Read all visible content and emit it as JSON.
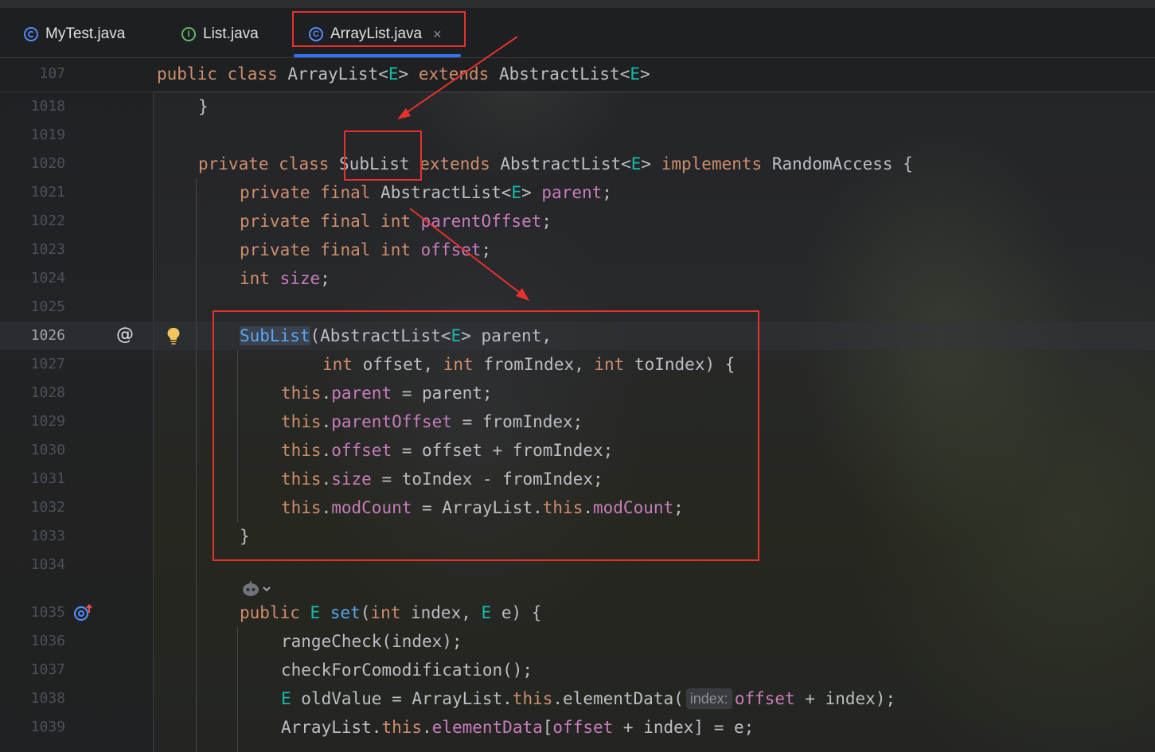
{
  "tabs": [
    {
      "label": "MyTest.java",
      "icon": "class-icon"
    },
    {
      "label": "List.java",
      "icon": "interface-icon",
      "icon_letter": "I"
    },
    {
      "label": "ArrayList.java",
      "icon": "class-icon",
      "icon_letter": "C",
      "active": true,
      "close": "×"
    }
  ],
  "sticky": {
    "line": "107"
  },
  "lines": [
    {
      "num": "1018"
    },
    {
      "num": "1019"
    },
    {
      "num": "1020"
    },
    {
      "num": "1021"
    },
    {
      "num": "1022"
    },
    {
      "num": "1023"
    },
    {
      "num": "1024"
    },
    {
      "num": "1025"
    },
    {
      "num": "1026"
    },
    {
      "num": "1027"
    },
    {
      "num": "1028"
    },
    {
      "num": "1029"
    },
    {
      "num": "1030"
    },
    {
      "num": "1031"
    },
    {
      "num": "1032"
    },
    {
      "num": "1033"
    },
    {
      "num": "1034"
    },
    {
      "num": "1035"
    },
    {
      "num": "1036"
    },
    {
      "num": "1037"
    },
    {
      "num": "1038"
    },
    {
      "num": "1039"
    }
  ],
  "tokens": {
    "public": "public",
    "class": "class",
    "private": "private",
    "final": "final",
    "int": "int",
    "extends": "extends",
    "implements": "implements",
    "this": "this",
    "ArrayList": "ArrayList",
    "E": "E",
    "lt": "<",
    "gt": ">",
    "brace_open": " {",
    "brace_close": "}",
    "AbstractList": "AbstractList",
    "SubList": "SubList",
    "RandomAccess": "RandomAccess",
    "parent": "parent",
    "parentOffset": "parentOffset",
    "offset": "offset",
    "size": "size",
    "modCount": "modCount",
    "semi": ";",
    "set": "set",
    "elementData": "elementData",
    "ctor_params1": "(AbstractList<",
    "ctor_params1b": "> parent,",
    "offset_param": " offset, ",
    "fromIndex_param": " fromIndex, ",
    "toIndex_param": " toIndex) {",
    "assign_parent": " = parent;",
    "assign_parentOffset": " = fromIndex;",
    "assign_offset": " = offset + fromIndex;",
    "assign_size": " = toIndex - fromIndex;",
    "assign_modCount": " = ArrayList.",
    "modCount_end": ";",
    "set_params": "(",
    "set_params2": " index, ",
    "set_params3": " e) {",
    "rangeCheck": "rangeCheck(index);",
    "checkForComod": "checkForComodification();",
    "oldValue": " oldValue = ArrayList.",
    "elementData_call": ".elementData(",
    "hint_index": "index:",
    "offset_idx": " + index);",
    "arr_prefix": "ArrayList.",
    "elementData_tail": "[",
    "elementData_end": " + index] = e;"
  }
}
